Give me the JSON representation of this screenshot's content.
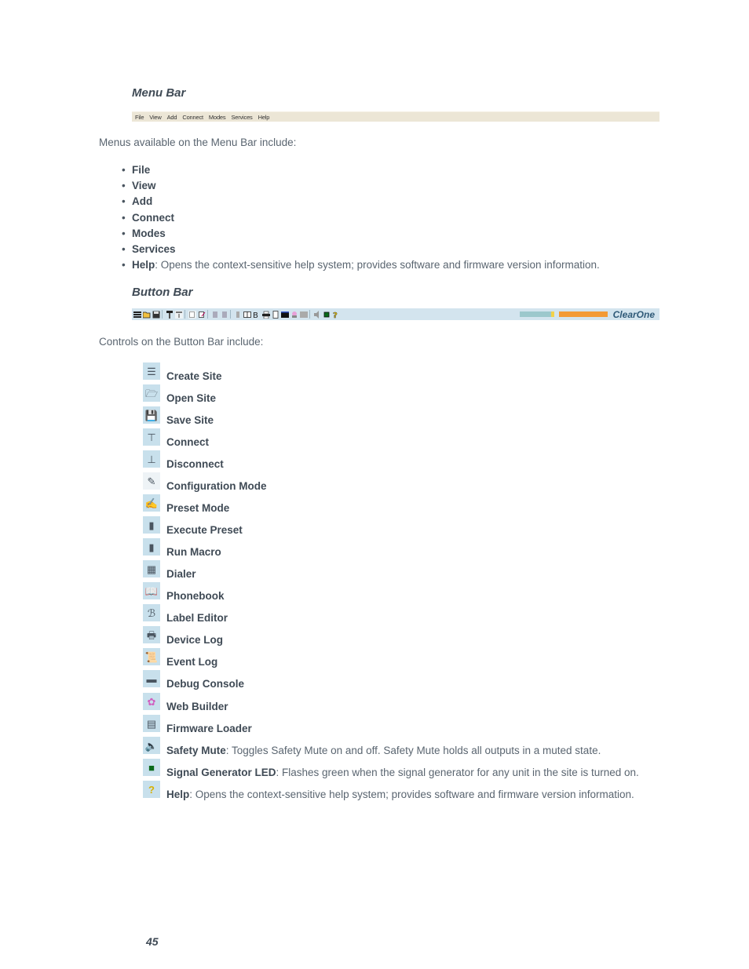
{
  "menu_bar_section": {
    "title": "Menu Bar",
    "menu_items": [
      "File",
      "View",
      "Add",
      "Connect",
      "Modes",
      "Services",
      "Help"
    ],
    "intro": "Menus available on the Menu Bar include:",
    "bullets": [
      {
        "term": "File",
        "desc": ""
      },
      {
        "term": "View",
        "desc": ""
      },
      {
        "term": "Add",
        "desc": ""
      },
      {
        "term": "Connect",
        "desc": ""
      },
      {
        "term": "Modes",
        "desc": ""
      },
      {
        "term": "Services",
        "desc": ""
      },
      {
        "term": "Help",
        "desc": ": Opens the context-sensitive help system; provides software and firmware version information."
      }
    ]
  },
  "button_bar_section": {
    "title": "Button Bar",
    "logo": "ClearOne",
    "intro": "Controls on the Button Bar include:",
    "controls": [
      {
        "icon": "create-site-icon",
        "glyph": "☰",
        "term": "Create Site",
        "desc": ""
      },
      {
        "icon": "open-site-icon",
        "glyph": "🗁",
        "term": "Open Site",
        "desc": ""
      },
      {
        "icon": "save-site-icon",
        "glyph": "💾",
        "term": "Save Site",
        "desc": ""
      },
      {
        "icon": "connect-icon",
        "glyph": "⊤",
        "term": "Connect",
        "desc": ""
      },
      {
        "icon": "disconnect-icon",
        "glyph": "⊥",
        "term": "Disconnect",
        "desc": ""
      },
      {
        "icon": "configuration-mode-icon",
        "glyph": "✎",
        "term": "Configuration Mode",
        "desc": ""
      },
      {
        "icon": "preset-mode-icon",
        "glyph": "✍",
        "term": "Preset Mode",
        "desc": ""
      },
      {
        "icon": "execute-preset-icon",
        "glyph": "▮",
        "term": "Execute Preset",
        "desc": ""
      },
      {
        "icon": "run-macro-icon",
        "glyph": "▮",
        "term": "Run Macro",
        "desc": ""
      },
      {
        "icon": "dialer-icon",
        "glyph": "▦",
        "term": "Dialer",
        "desc": ""
      },
      {
        "icon": "phonebook-icon",
        "glyph": "📖",
        "term": "Phonebook",
        "desc": ""
      },
      {
        "icon": "label-editor-icon",
        "glyph": "ℬ",
        "term": "Label Editor",
        "desc": ""
      },
      {
        "icon": "device-log-icon",
        "glyph": "🖶",
        "term": "Device Log",
        "desc": ""
      },
      {
        "icon": "event-log-icon",
        "glyph": "📜",
        "term": "Event Log",
        "desc": ""
      },
      {
        "icon": "debug-console-icon",
        "glyph": "▬",
        "term": "Debug Console",
        "desc": ""
      },
      {
        "icon": "web-builder-icon",
        "glyph": "✿",
        "term": "Web Builder",
        "desc": ""
      },
      {
        "icon": "firmware-loader-icon",
        "glyph": "▤",
        "term": "Firmware Loader",
        "desc": ""
      },
      {
        "icon": "safety-mute-icon",
        "glyph": "🔈",
        "term": "Safety Mute",
        "desc": ": Toggles Safety Mute on and off. Safety Mute holds all outputs in a muted state."
      },
      {
        "icon": "signal-generator-led-icon",
        "glyph": "■",
        "term": "Signal Generator LED",
        "desc": ": Flashes green when the signal generator for any unit in the site is turned on."
      },
      {
        "icon": "help-icon",
        "glyph": "?",
        "term": "Help",
        "desc": ": Opens the context-sensitive help system; provides software and firmware version information."
      }
    ]
  },
  "colors": {
    "menubar_bg": "#ece6d6",
    "buttonbar_bg": "#d3e4ee",
    "accent_orange": "#f39a35",
    "accent_teal": "#9cc8cc",
    "accent_yellow": "#f2d24a",
    "logo_blue": "#2f5a78"
  },
  "page_number": "45"
}
